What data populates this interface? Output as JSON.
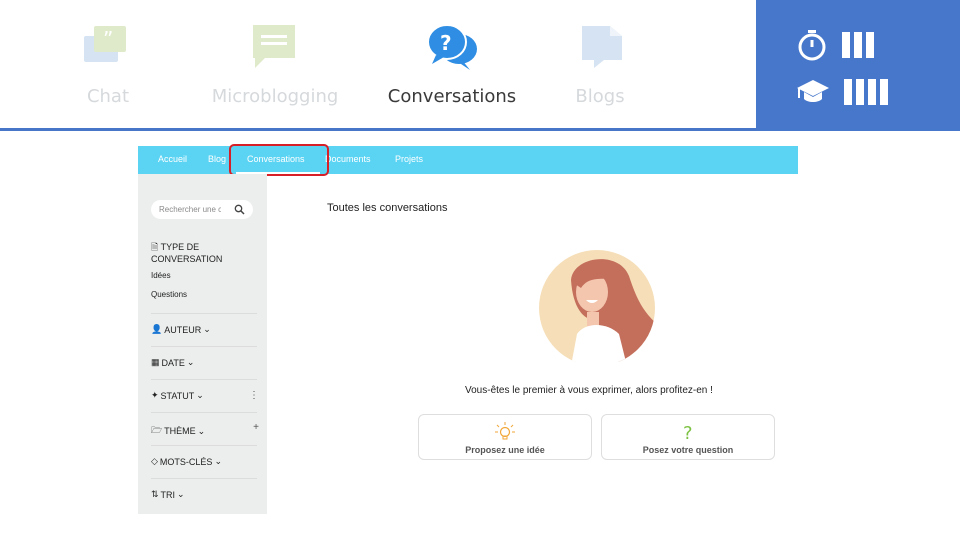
{
  "header": {
    "categories": [
      {
        "label": "Chat",
        "icon": "chat-icon",
        "active": false
      },
      {
        "label": "Microblogging",
        "icon": "microblogging-icon",
        "active": false
      },
      {
        "label": "Conversations",
        "icon": "conversations-icon",
        "active": true
      },
      {
        "label": "Blogs",
        "icon": "blogs-icon",
        "active": false
      }
    ],
    "meta": {
      "duration_icon": "stopwatch-icon",
      "duration_level": 3,
      "difficulty_icon": "graduation-cap-icon",
      "difficulty_level": 4
    },
    "colors": {
      "accent": "#4677cb"
    }
  },
  "app": {
    "nav": [
      {
        "label": "Accueil"
      },
      {
        "label": "Blog"
      },
      {
        "label": "Conversations"
      },
      {
        "label": "Documents"
      },
      {
        "label": "Projets"
      }
    ],
    "active_tab": "Conversations",
    "colors": {
      "nav": "#5bd4f3",
      "highlight": "#d61f26"
    },
    "sidebar": {
      "search_placeholder": "Rechercher une conversation",
      "type_title_1": "TYPE DE",
      "type_title_2": "CONVERSATION",
      "type_options": [
        "Idées",
        "Questions"
      ],
      "filters": [
        {
          "label": "AUTEUR",
          "icon": "user-icon"
        },
        {
          "label": "DATE",
          "icon": "calendar-icon"
        },
        {
          "label": "STATUT",
          "icon": "wand-icon"
        },
        {
          "label": "THÈME",
          "icon": "folder-icon"
        },
        {
          "label": "MOTS-CLÉS",
          "icon": "tag-icon"
        },
        {
          "label": "TRI",
          "icon": "sort-icon"
        }
      ],
      "statut_extra": "⋮",
      "theme_extra": "+"
    },
    "main": {
      "title": "Toutes les conversations",
      "empty_message": "Vous-êtes le premier à vous exprimer, alors profitez-en !",
      "actions": [
        {
          "label": "Proposez une idée",
          "icon": "lightbulb-icon"
        },
        {
          "label": "Posez votre question",
          "icon": "question-mark-icon"
        }
      ]
    }
  }
}
